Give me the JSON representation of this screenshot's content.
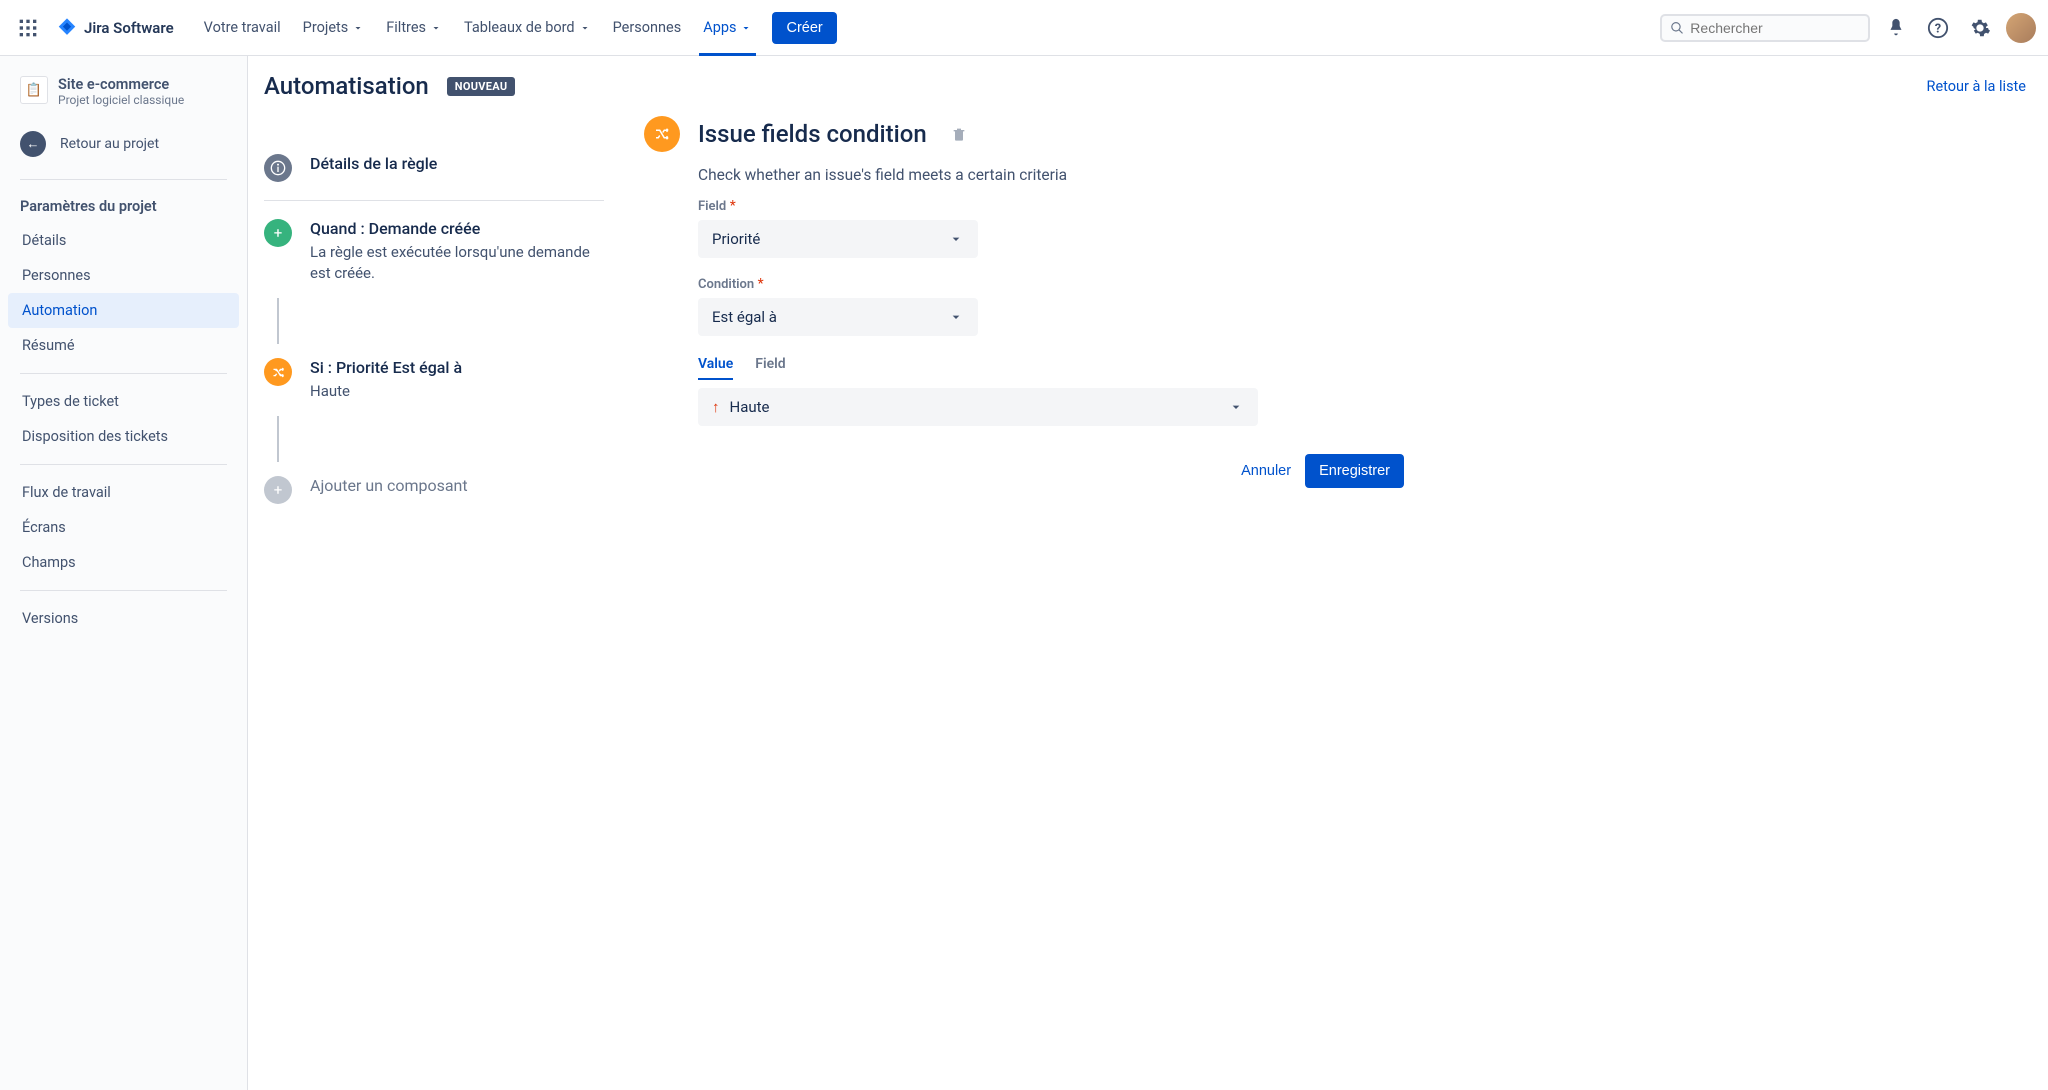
{
  "topnav": {
    "logo": "Jira Software",
    "items": [
      "Votre travail",
      "Projets",
      "Filtres",
      "Tableaux de bord",
      "Personnes",
      "Apps"
    ],
    "create": "Créer",
    "search_placeholder": "Rechercher"
  },
  "sidebar": {
    "project_name": "Site e-commerce",
    "project_type": "Projet logiciel classique",
    "back_label": "Retour au projet",
    "section_title": "Paramètres du projet",
    "items1": [
      "Détails",
      "Personnes",
      "Automation",
      "Résumé"
    ],
    "items2": [
      "Types de ticket",
      "Disposition des tickets"
    ],
    "items3": [
      "Flux de travail",
      "Écrans",
      "Champs"
    ],
    "items4": [
      "Versions"
    ]
  },
  "page": {
    "title": "Automatisation",
    "badge": "NOUVEAU",
    "return": "Retour à la liste"
  },
  "rule": {
    "details": "Détails de la règle",
    "trigger_title": "Quand : Demande créée",
    "trigger_desc": "La règle est exécutée lorsqu'une demande est créée.",
    "cond_title": "Si : Priorité Est égal à",
    "cond_value": "Haute",
    "add": "Ajouter un composant"
  },
  "detail": {
    "title": "Issue fields condition",
    "desc": "Check whether an issue's field meets a certain criteria",
    "field_label": "Field",
    "field_value": "Priorité",
    "condition_label": "Condition",
    "condition_value": "Est égal à",
    "tab_value": "Value",
    "tab_field": "Field",
    "value_value": "Haute",
    "cancel": "Annuler",
    "save": "Enregistrer"
  }
}
